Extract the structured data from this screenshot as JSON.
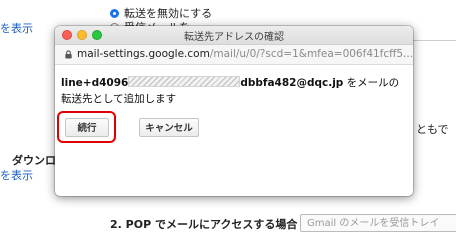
{
  "background": {
    "show_link_1": "を表示",
    "show_link_2": "を表示",
    "radio_disable_forwarding": "転送を無効にする",
    "radio_keep_copy": "受信メールを",
    "download_heading": "ダウンロ",
    "right_fragment": "ともで",
    "pop_access_label": "2. POP でメールにアクセスする場合",
    "pop_select_value": "Gmail のメールを受信トレイ"
  },
  "popup": {
    "window_title": "転送先アドレスの確認",
    "url_host": "mail-settings.google.com",
    "url_path": "/mail/u/0/?scd=1&mfea=006f41fcff5...",
    "message_addr_start": "line+d4096",
    "message_addr_end": "dbbfa482@dqc.jp",
    "message_text": " をメールの転送先として追加します",
    "continue_label": "続行",
    "cancel_label": "キャンセル"
  },
  "colors": {
    "link": "#1a5fc2",
    "highlight": "#e00000",
    "radio_checked": "#1a73e8"
  }
}
